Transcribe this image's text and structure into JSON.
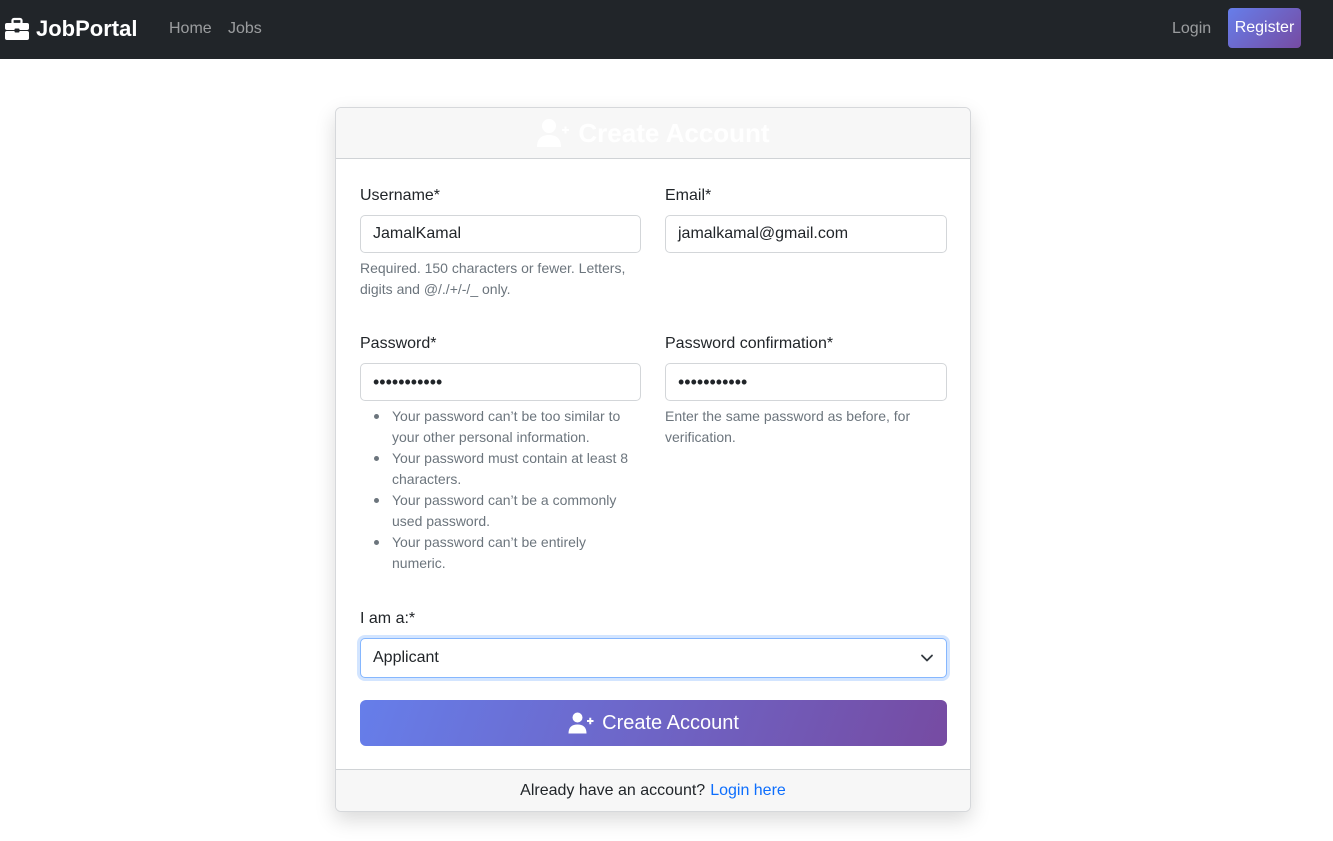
{
  "navbar": {
    "brand": "JobPortal",
    "brand_icon": "briefcase-icon",
    "links": {
      "home": "Home",
      "jobs": "Jobs",
      "login": "Login"
    },
    "register_label": "Register"
  },
  "card": {
    "header_title": "Create Account",
    "header_icon": "user-plus-icon",
    "fields": {
      "username": {
        "label": "Username*",
        "value": "JamalKamal",
        "help_1": "Required. 150 characters or fewer. Letters,",
        "help_2": "digits and @/./+/-/_ only."
      },
      "email": {
        "label": "Email*",
        "value": "jamalkamal@gmail.com"
      },
      "password": {
        "label": "Password*",
        "value": "•••••••••••",
        "help": [
          [
            "Your password can’t be too similar to",
            "your other personal information."
          ],
          [
            "Your password must contain at least 8",
            "characters."
          ],
          [
            "Your password can’t be a commonly",
            "used password."
          ],
          [
            "Your password can’t be entirely",
            "numeric."
          ]
        ]
      },
      "password_confirmation": {
        "label": "Password confirmation*",
        "value": "•••••••••••",
        "help_1": "Enter the same password as before, for",
        "help_2": "verification."
      },
      "role": {
        "label": "I am a:*",
        "selected": "Applicant"
      }
    },
    "submit_label": "Create Account",
    "footer": {
      "text": "Already have an account?",
      "link": "Login here"
    }
  },
  "colors": {
    "navbar_bg": "#212529",
    "gradient_start": "#667eea",
    "gradient_end": "#764ba2",
    "link": "#0d6efd"
  }
}
